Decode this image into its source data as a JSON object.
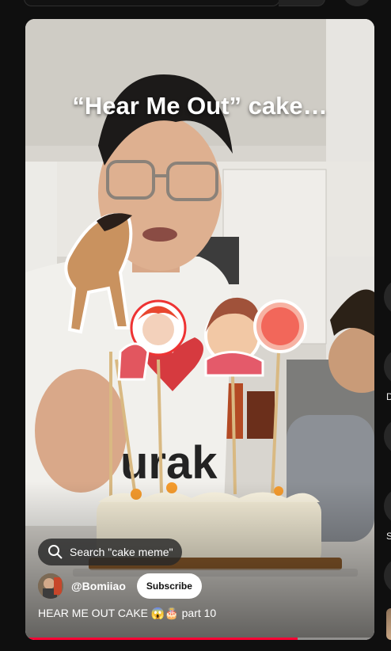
{
  "video": {
    "overlay_caption": "“Hear Me Out” cake…",
    "search_chip_label": "Search \"cake meme\"",
    "channel_handle": "@Bomiiao",
    "subscribe_label": "Subscribe",
    "title": "HEAR ME OUT CAKE 😱🎂 part 10",
    "progress_fraction": 0.78
  },
  "right_rail": {
    "labels": [
      "D",
      "S"
    ]
  },
  "colors": {
    "background": "#0f0f0f",
    "progress": "#ff0033",
    "subscribe_bg": "#ffffff"
  }
}
